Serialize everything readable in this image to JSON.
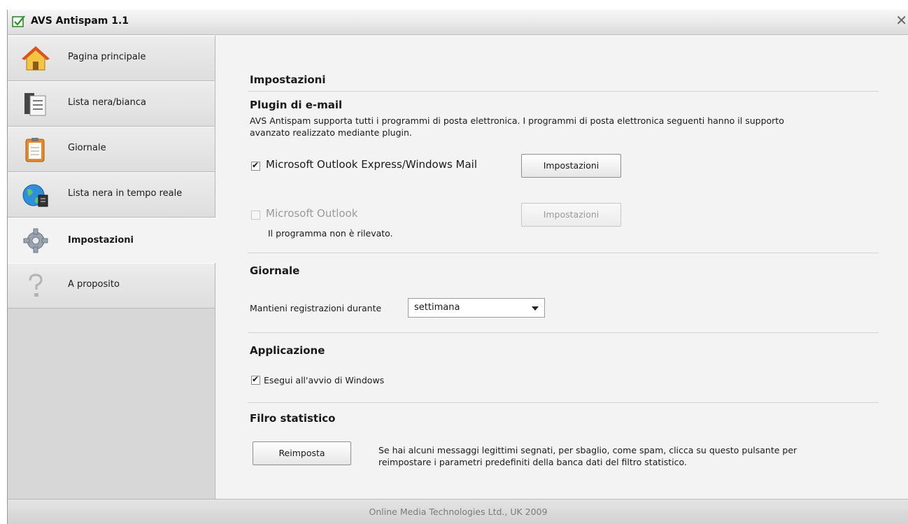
{
  "window": {
    "title": "AVS Antispam 1.1",
    "close_glyph": "✕"
  },
  "sidebar": {
    "items": [
      {
        "label": "Pagina principale",
        "icon": "home-icon"
      },
      {
        "label": "Lista nera/bianca",
        "icon": "list-document-icon"
      },
      {
        "label": "Giornale",
        "icon": "clipboard-icon"
      },
      {
        "label": "Lista nera in tempo reale",
        "icon": "globe-icon"
      },
      {
        "label": "Impostazioni",
        "icon": "gear-icon",
        "active": true
      },
      {
        "label": "A proposito",
        "icon": "question-icon"
      }
    ]
  },
  "main": {
    "title": "Impostazioni",
    "plugins": {
      "heading": "Plugin di e-mail",
      "description_line1": "AVS Antispam supporta tutti i programmi di posta elettronica. I programmi di posta elettronica seguenti hanno il supporto",
      "description_line2": "avanzato realizzato mediante plugin.",
      "outlook_express": {
        "label": "Microsoft Outlook Express/Windows Mail",
        "checked": true,
        "button": "Impostazioni"
      },
      "outlook": {
        "label": "Microsoft Outlook",
        "checked": false,
        "enabled": false,
        "button": "Impostazioni",
        "note": "Il programma non è rilevato."
      }
    },
    "journal": {
      "heading": "Giornale",
      "keep_label": "Mantieni registrazioni durante",
      "keep_value": "settimana"
    },
    "application": {
      "heading": "Applicazione",
      "startup_label": "Esegui all'avvio di Windows",
      "startup_checked": true
    },
    "stat_filter": {
      "heading": "Filro statistico",
      "reset_button": "Reimposta",
      "description_line1": "Se hai alcuni messaggi legittimi segnati, per sbaglio, come spam, clicca su questo pulsante per",
      "description_line2": "reimpostare i parametri predefiniti della banca dati del filtro statistico."
    }
  },
  "status": {
    "text": "Online Media Technologies Ltd., UK 2009"
  },
  "colors": {
    "sidebar_bg": "#d7d7d7",
    "content_bg": "#f3f3f3",
    "disabled_text": "#9a9a9a"
  }
}
